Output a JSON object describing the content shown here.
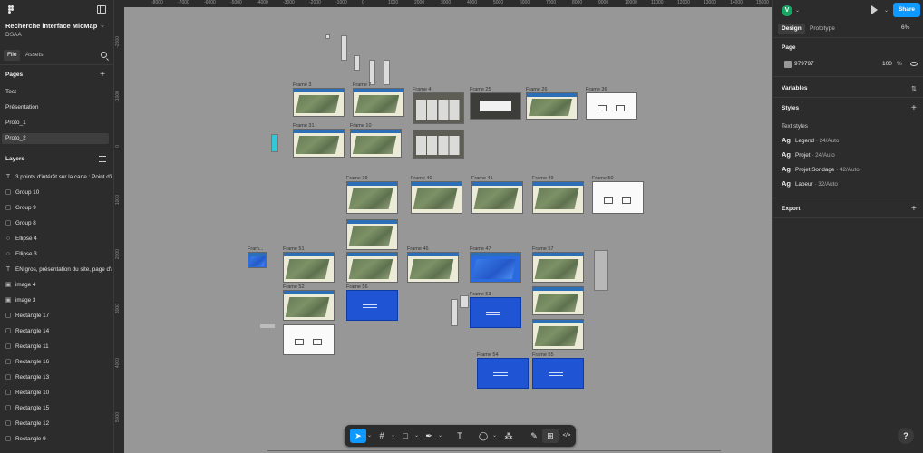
{
  "project": {
    "title": "Recherche interface MicMap",
    "team": "DSAA"
  },
  "left_tabs": {
    "file": "File",
    "assets": "Assets"
  },
  "pages": {
    "title": "Pages",
    "items": [
      "Test",
      "Présentation",
      "Proto_1",
      "Proto_2"
    ],
    "active_index": 3
  },
  "layers": {
    "title": "Layers",
    "items": [
      {
        "icon": "text-icon",
        "glyph": "T",
        "label": "3 points d'intérêt sur la carte : Point d'i"
      },
      {
        "icon": "frame-icon",
        "glyph": "▢",
        "label": "Group 10"
      },
      {
        "icon": "frame-icon",
        "glyph": "▢",
        "label": "Group 9"
      },
      {
        "icon": "frame-icon",
        "glyph": "▢",
        "label": "Group 8"
      },
      {
        "icon": "ellipse-icon",
        "glyph": "○",
        "label": "Ellipse 4"
      },
      {
        "icon": "ellipse-icon",
        "glyph": "○",
        "label": "Ellipse 3"
      },
      {
        "icon": "text-icon",
        "glyph": "T",
        "label": "EN gros, présentation du site, page d'a"
      },
      {
        "icon": "image-icon",
        "glyph": "▣",
        "label": "image 4"
      },
      {
        "icon": "image-icon",
        "glyph": "▣",
        "label": "image 3"
      },
      {
        "icon": "rectangle-icon",
        "glyph": "▢",
        "label": "Rectangle 17"
      },
      {
        "icon": "rectangle-icon",
        "glyph": "▢",
        "label": "Rectangle 14"
      },
      {
        "icon": "rectangle-icon",
        "glyph": "▢",
        "label": "Rectangle 11"
      },
      {
        "icon": "rectangle-icon",
        "glyph": "▢",
        "label": "Rectangle 16"
      },
      {
        "icon": "rectangle-icon",
        "glyph": "▢",
        "label": "Rectangle 13"
      },
      {
        "icon": "rectangle-icon",
        "glyph": "▢",
        "label": "Rectangle 10"
      },
      {
        "icon": "rectangle-icon",
        "glyph": "▢",
        "label": "Rectangle 15"
      },
      {
        "icon": "rectangle-icon",
        "glyph": "▢",
        "label": "Rectangle 12"
      },
      {
        "icon": "rectangle-icon",
        "glyph": "▢",
        "label": "Rectangle 9"
      }
    ]
  },
  "ruler": {
    "ticks": [
      "-8000",
      "-7000",
      "-6000",
      "-5000",
      "-4000",
      "-3000",
      "-2000",
      "-1000",
      "0",
      "1000",
      "2000",
      "3000",
      "4000",
      "5000",
      "6000",
      "7000",
      "8000",
      "9000",
      "10000",
      "11000",
      "12000",
      "13000",
      "14000",
      "15000",
      "16000"
    ]
  },
  "canvas": {
    "background": "#979797",
    "frames": [
      {
        "label": "Frame 3",
        "style": "map"
      },
      {
        "label": "Frame 7",
        "style": "map"
      },
      {
        "label": "Frame 4",
        "style": "dark"
      },
      {
        "label": "Frame 25",
        "style": "dark2"
      },
      {
        "label": "Frame 26",
        "style": "map"
      },
      {
        "label": "Frame 36",
        "style": "white"
      },
      {
        "label": "Frame 31",
        "style": "map"
      },
      {
        "label": "Frame 10",
        "style": "map"
      },
      {
        "label": "",
        "style": "dark"
      },
      {
        "label": "Frame 39",
        "style": "map"
      },
      {
        "label": "Frame 40",
        "style": "map"
      },
      {
        "label": "Frame 41",
        "style": "map"
      },
      {
        "label": "Frame 49",
        "style": "map"
      },
      {
        "label": "Frame 50",
        "style": "white"
      },
      {
        "label": "",
        "style": "map"
      },
      {
        "label": "Fram...",
        "style": "bluemap"
      },
      {
        "label": "Frame 51",
        "style": "map"
      },
      {
        "label": "",
        "style": "map"
      },
      {
        "label": "Frame 46",
        "style": "map"
      },
      {
        "label": "Frame 47",
        "style": "bluemap"
      },
      {
        "label": "Frame 57",
        "style": "map"
      },
      {
        "label": "Frame 52",
        "style": "map"
      },
      {
        "label": "Frame 56",
        "style": "blue"
      },
      {
        "label": "Frame 53",
        "style": "blue"
      },
      {
        "label": "",
        "style": "map"
      },
      {
        "label": "",
        "style": "white"
      },
      {
        "label": "",
        "style": "map"
      },
      {
        "label": "Frame 54",
        "style": "blue"
      },
      {
        "label": "Frame 55",
        "style": "blue"
      }
    ]
  },
  "toolbar": {
    "tools": [
      {
        "icon": "move-icon",
        "glyph": "➤",
        "active": true,
        "chevron": true
      },
      {
        "icon": "frame-tool-icon",
        "glyph": "#",
        "active": false,
        "chevron": true
      },
      {
        "icon": "rectangle-tool-icon",
        "glyph": "□",
        "active": false,
        "chevron": true
      },
      {
        "icon": "pen-tool-icon",
        "glyph": "✒",
        "active": false,
        "chevron": true
      },
      {
        "icon": "text-tool-icon",
        "glyph": "T",
        "active": false,
        "chevron": false
      },
      {
        "icon": "comment-tool-icon",
        "glyph": "◯",
        "active": false,
        "chevron": true
      },
      {
        "icon": "actions-icon",
        "glyph": "⁂",
        "active": false,
        "chevron": false
      },
      {
        "icon": "draw-mode-icon",
        "glyph": "✎",
        "active": false,
        "chevron": false
      },
      {
        "icon": "design-mode-icon",
        "glyph": "⊞",
        "active": true,
        "chevron": false
      },
      {
        "icon": "dev-mode-icon",
        "glyph": "</>",
        "active": false,
        "chevron": false
      }
    ]
  },
  "right": {
    "avatar_letter": "V",
    "avatar_color": "#19a463",
    "share_label": "Share",
    "tabs": {
      "design": "Design",
      "prototype": "Prototype"
    },
    "zoom": "6%",
    "page_section": {
      "title": "Page",
      "color_hex": "979797",
      "opacity": "100",
      "opacity_unit": "%"
    },
    "variables": "Variables",
    "styles": "Styles",
    "text_styles_label": "Text styles",
    "text_styles": [
      {
        "ag": "Ag",
        "name": "Legend",
        "meta": "24/Auto"
      },
      {
        "ag": "Ag",
        "name": "Projet",
        "meta": "24/Auto"
      },
      {
        "ag": "Ag",
        "name": "Projet Sondage",
        "meta": "42/Auto"
      },
      {
        "ag": "Ag",
        "name": "Labeur",
        "meta": "32/Auto"
      }
    ],
    "export": "Export",
    "help": "?"
  },
  "colors": {
    "accent": "#0d99ff",
    "panel": "#2c2c2c",
    "canvas": "#979797"
  }
}
